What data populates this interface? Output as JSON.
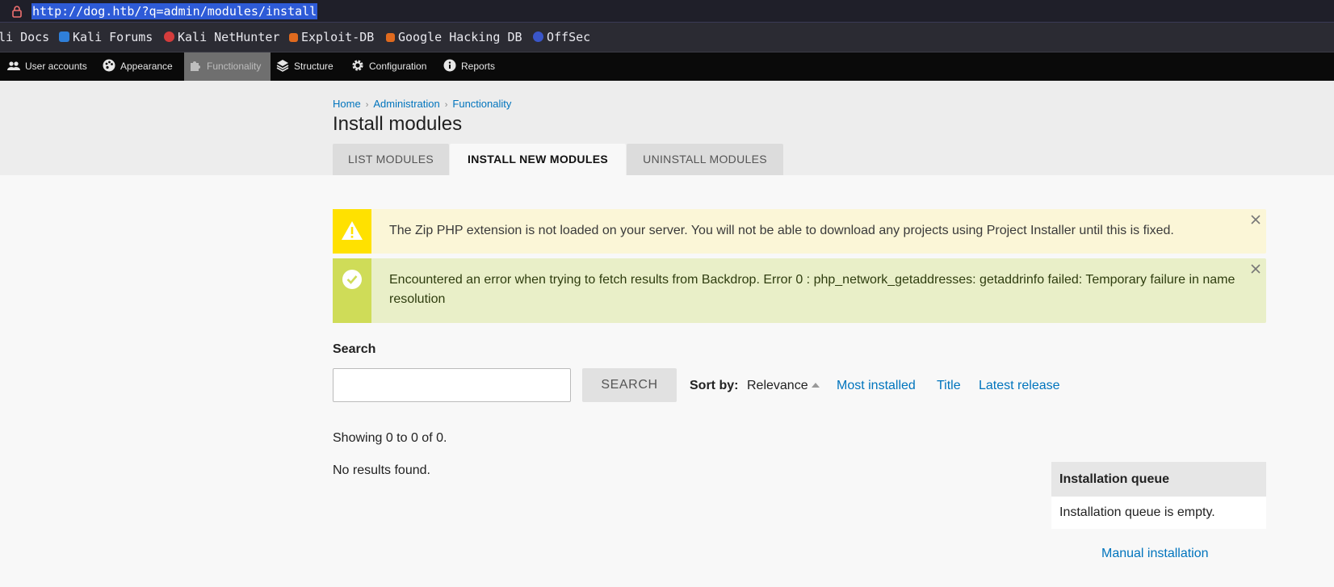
{
  "browser": {
    "url": "http://dog.htb/?q=admin/modules/install",
    "bookmarks": [
      {
        "label": "li Docs",
        "icon": "kali-docs-icon",
        "color": "#3b6fd6"
      },
      {
        "label": "Kali Forums",
        "icon": "kali-forums-icon",
        "color": "#2f7fd9"
      },
      {
        "label": "Kali NetHunter",
        "icon": "kali-nethunter-icon",
        "color": "#d43c3c"
      },
      {
        "label": "Exploit-DB",
        "icon": "exploit-db-icon",
        "color": "#e06a1e"
      },
      {
        "label": "Google Hacking DB",
        "icon": "ghdb-icon",
        "color": "#e06a1e"
      },
      {
        "label": "OffSec",
        "icon": "offsec-icon",
        "color": "#3a56c9"
      }
    ]
  },
  "admin_bar": {
    "items": [
      {
        "label": "User accounts",
        "icon": "users-icon"
      },
      {
        "label": "Appearance",
        "icon": "palette-icon"
      },
      {
        "label": "Functionality",
        "icon": "puzzle-icon",
        "active": true
      },
      {
        "label": "Structure",
        "icon": "layers-icon"
      },
      {
        "label": "Configuration",
        "icon": "gear-icon"
      },
      {
        "label": "Reports",
        "icon": "info-icon"
      }
    ]
  },
  "breadcrumb": [
    "Home",
    "Administration",
    "Functionality"
  ],
  "page_title": "Install modules",
  "tabs": [
    {
      "label": "LIST MODULES"
    },
    {
      "label": "INSTALL NEW MODULES",
      "active": true
    },
    {
      "label": "UNINSTALL MODULES"
    }
  ],
  "messages": {
    "warning": "The Zip PHP extension is not loaded on your server. You will not be able to download any projects using Project Installer until this is fixed.",
    "status": "Encountered an error when trying to fetch results from Backdrop. Error 0 : php_network_getaddresses: getaddrinfo failed: Temporary failure in name resolution"
  },
  "search": {
    "label": "Search",
    "value": "",
    "button": "SEARCH",
    "sort_label": "Sort by:",
    "sort_current": "Relevance",
    "sort_links": [
      "Most installed",
      "Title",
      "Latest release"
    ]
  },
  "results": {
    "showing": "Showing 0 to 0 of 0.",
    "empty": "No results found."
  },
  "queue": {
    "title": "Installation queue",
    "body": "Installation queue is empty.",
    "manual_link": "Manual installation"
  },
  "colors": {
    "link": "#0074bd",
    "warning_accent": "#ffe100",
    "status_accent": "#cfdc58"
  }
}
